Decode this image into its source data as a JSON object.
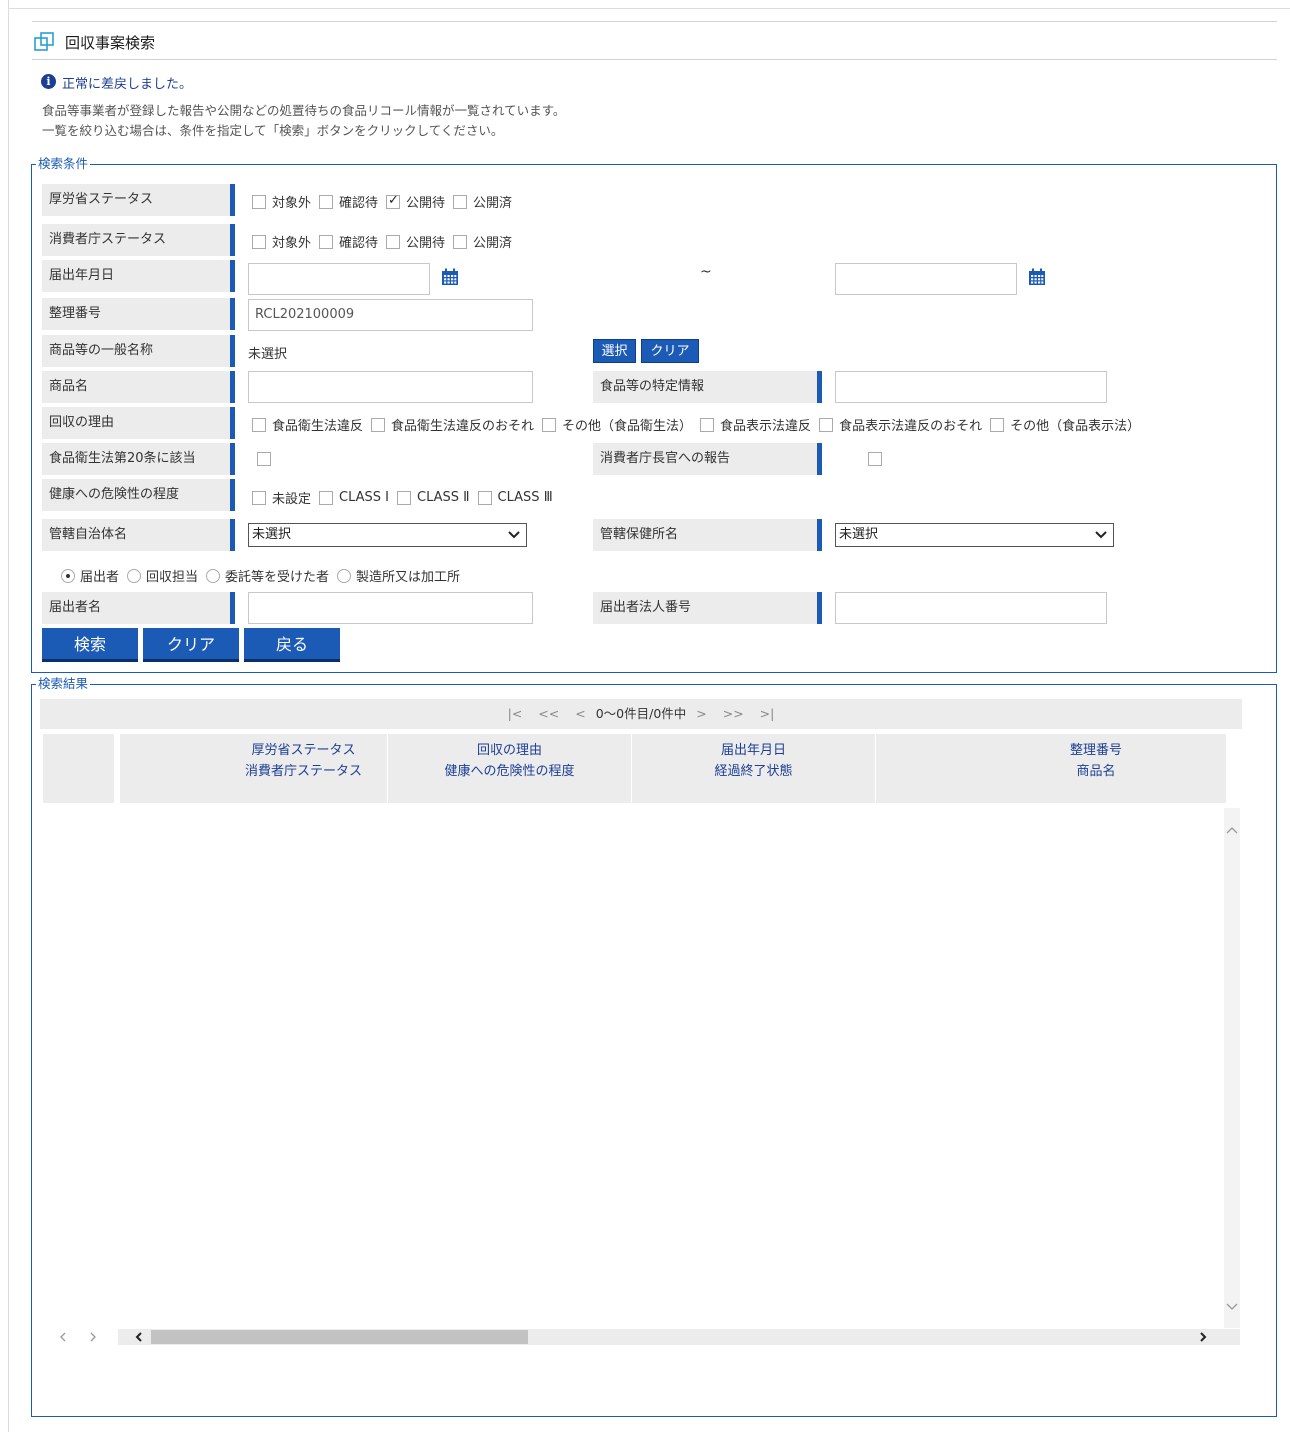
{
  "page": {
    "title": "回収事案検索",
    "info_message": "正常に差戻しました。",
    "description_line1": "食品等事業者が登録した報告や公開などの処置待ちの食品リコール情報が一覧されています。",
    "description_line2": "一覧を絞り込む場合は、条件を指定して「検索」ボタンをクリックしてください。"
  },
  "search": {
    "legend": "検索条件",
    "mhlw_status": {
      "label": "厚労省ステータス",
      "options": [
        {
          "label": "対象外",
          "checked": false
        },
        {
          "label": "確認待",
          "checked": false
        },
        {
          "label": "公開待",
          "checked": true
        },
        {
          "label": "公開済",
          "checked": false
        }
      ]
    },
    "caa_status": {
      "label": "消費者庁ステータス",
      "options": [
        {
          "label": "対象外",
          "checked": false
        },
        {
          "label": "確認待",
          "checked": false
        },
        {
          "label": "公開待",
          "checked": false
        },
        {
          "label": "公開済",
          "checked": false
        }
      ]
    },
    "filing_date": {
      "label": "届出年月日",
      "separator": "~",
      "from": "",
      "to": ""
    },
    "reference_number": {
      "label": "整理番号",
      "value": "RCL202100009"
    },
    "general_name": {
      "label": "商品等の一般名称",
      "value": "未選択",
      "select_label": "選択",
      "clear_label": "クリア"
    },
    "product_name": {
      "label": "商品名",
      "value": ""
    },
    "specific_info": {
      "label": "食品等の特定情報",
      "value": ""
    },
    "recall_reason": {
      "label": "回収の理由",
      "options": [
        "食品衛生法違反",
        "食品衛生法違反のおそれ",
        "その他（食品衛生法）",
        "食品表示法違反",
        "食品表示法違反のおそれ",
        "その他（食品表示法）"
      ]
    },
    "article20": {
      "label": "食品衛生法第20条に該当"
    },
    "commissioner_report": {
      "label": "消費者庁長官への報告"
    },
    "health_risk": {
      "label": "健康への危険性の程度",
      "options": [
        "未設定",
        "CLASS Ⅰ",
        "CLASS Ⅱ",
        "CLASS Ⅲ"
      ]
    },
    "municipality": {
      "label": "管轄自治体名",
      "value": "未選択"
    },
    "health_center": {
      "label": "管轄保健所名",
      "value": "未選択"
    },
    "party_type": {
      "options": [
        {
          "label": "届出者",
          "checked": true
        },
        {
          "label": "回収担当",
          "checked": false
        },
        {
          "label": "委託等を受けた者",
          "checked": false
        },
        {
          "label": "製造所又は加工所",
          "checked": false
        }
      ]
    },
    "filer_name": {
      "label": "届出者名",
      "value": ""
    },
    "corp_number": {
      "label": "届出者法人番号",
      "value": ""
    },
    "buttons": {
      "search": "検索",
      "clear": "クリア",
      "back": "戻る"
    }
  },
  "results": {
    "legend": "検索結果",
    "pager": {
      "first": "|<",
      "prev2": "<<",
      "prev": "<",
      "summary": "0～0件目/0件中",
      "next": ">",
      "next2": ">>",
      "last": ">|"
    },
    "columns": [
      {
        "line1": "厚労省ステータス",
        "line2": "消費者庁ステータス"
      },
      {
        "line1": "回収の理由",
        "line2": "健康への危険性の程度"
      },
      {
        "line1": "届出年月日",
        "line2": "経過終了状態"
      },
      {
        "line1": "整理番号",
        "line2": "商品名"
      }
    ],
    "rows": []
  }
}
